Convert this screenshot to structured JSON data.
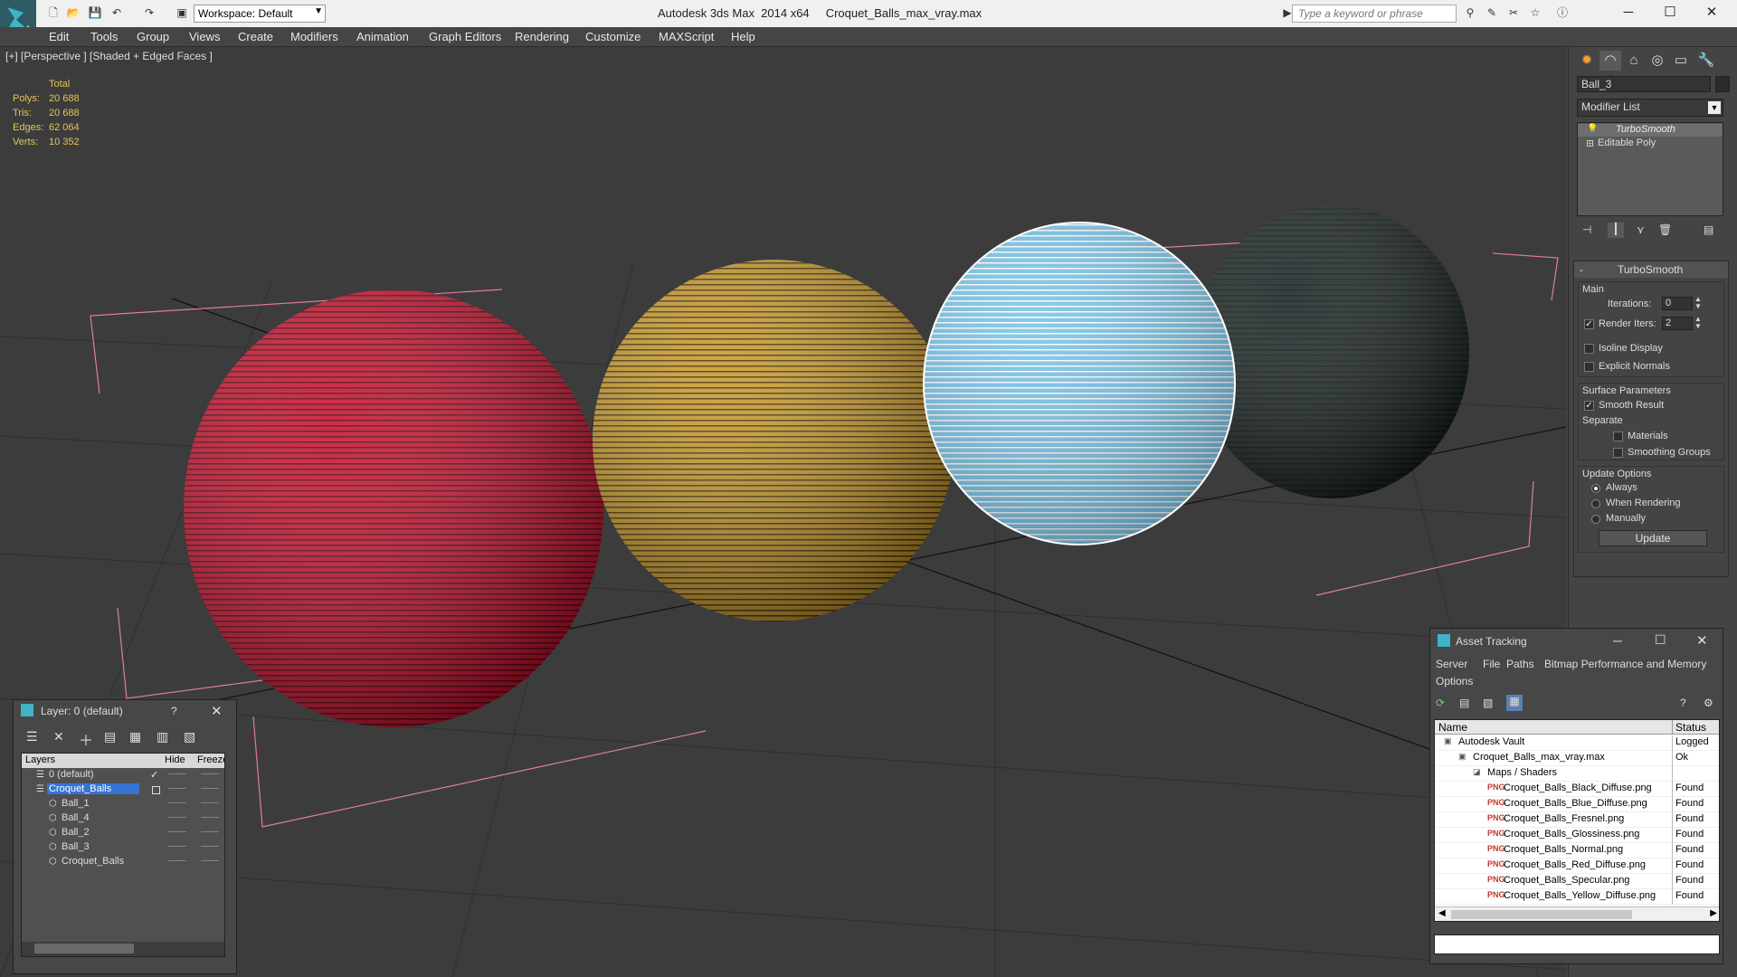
{
  "titlebar": {
    "app_title": "Autodesk 3ds Max  2014 x64     Croquet_Balls_max_vray.max",
    "workspace": "Workspace: Default",
    "search_placeholder": "Type a keyword or phrase"
  },
  "menu": [
    "Edit",
    "Tools",
    "Group",
    "Views",
    "Create",
    "Modifiers",
    "Animation",
    "Graph Editors",
    "Rendering",
    "Customize",
    "MAXScript",
    "Help"
  ],
  "viewport": {
    "label": "[+] [Perspective ] [Shaded + Edged Faces ]",
    "stats_header": "Total",
    "stats": [
      {
        "label": "Polys:",
        "value": "20 688"
      },
      {
        "label": "Tris:",
        "value": "20 688"
      },
      {
        "label": "Edges:",
        "value": "62 064"
      },
      {
        "label": "Verts:",
        "value": "10 352"
      }
    ],
    "balls": [
      {
        "name": "red",
        "color": "#c8102e"
      },
      {
        "name": "yellow",
        "color": "#c9992a"
      },
      {
        "name": "blue",
        "color": "#7fc6e8"
      },
      {
        "name": "black",
        "color": "#1a2424"
      }
    ]
  },
  "command_panel": {
    "object_name": "Ball_3",
    "modifier_list": "Modifier List",
    "stack": [
      "TurboSmooth",
      "Editable Poly"
    ],
    "rollout_title": "TurboSmooth",
    "main_group": "Main",
    "iterations_label": "Iterations:",
    "iterations_value": "0",
    "render_iters_label": "Render Iters:",
    "render_iters_value": "2",
    "isoline_label": "Isoline Display",
    "explicit_normals_label": "Explicit Normals",
    "surface_group": "Surface Parameters",
    "smooth_result_label": "Smooth Result",
    "separate_label": "Separate",
    "materials_label": "Materials",
    "smoothing_groups_label": "Smoothing Groups",
    "update_group": "Update Options",
    "always_label": "Always",
    "when_rendering_label": "When Rendering",
    "manually_label": "Manually",
    "update_button": "Update"
  },
  "layer_window": {
    "title": "Layer: 0 (default)",
    "help": "?",
    "col_layers": "Layers",
    "col_hide": "Hide",
    "col_freeze": "Freeze",
    "rows": [
      {
        "name": "0 (default)",
        "indent": 1,
        "selected": false
      },
      {
        "name": "Croquet_Balls",
        "indent": 1,
        "selected": true
      },
      {
        "name": "Ball_1",
        "indent": 2,
        "selected": false
      },
      {
        "name": "Ball_4",
        "indent": 2,
        "selected": false
      },
      {
        "name": "Ball_2",
        "indent": 2,
        "selected": false
      },
      {
        "name": "Ball_3",
        "indent": 2,
        "selected": false
      },
      {
        "name": "Croquet_Balls",
        "indent": 2,
        "selected": false
      }
    ]
  },
  "asset_window": {
    "title": "Asset Tracking",
    "menus": [
      "Server",
      "File",
      "Paths",
      "Bitmap Performance and Memory",
      "Options"
    ],
    "col_name": "Name",
    "col_status": "Status",
    "rows": [
      {
        "name": "Autodesk Vault",
        "status": "Logged",
        "indent": 1
      },
      {
        "name": "Croquet_Balls_max_vray.max",
        "status": "Ok",
        "indent": 2
      },
      {
        "name": "Maps / Shaders",
        "status": "",
        "indent": 3
      },
      {
        "name": "Croquet_Balls_Black_Diffuse.png",
        "status": "Found",
        "indent": 4
      },
      {
        "name": "Croquet_Balls_Blue_Diffuse.png",
        "status": "Found",
        "indent": 4
      },
      {
        "name": "Croquet_Balls_Fresnel.png",
        "status": "Found",
        "indent": 4
      },
      {
        "name": "Croquet_Balls_Glossiness.png",
        "status": "Found",
        "indent": 4
      },
      {
        "name": "Croquet_Balls_Normal.png",
        "status": "Found",
        "indent": 4
      },
      {
        "name": "Croquet_Balls_Red_Diffuse.png",
        "status": "Found",
        "indent": 4
      },
      {
        "name": "Croquet_Balls_Specular.png",
        "status": "Found",
        "indent": 4
      },
      {
        "name": "Croquet_Balls_Yellow_Diffuse.png",
        "status": "Found",
        "indent": 4
      }
    ]
  }
}
